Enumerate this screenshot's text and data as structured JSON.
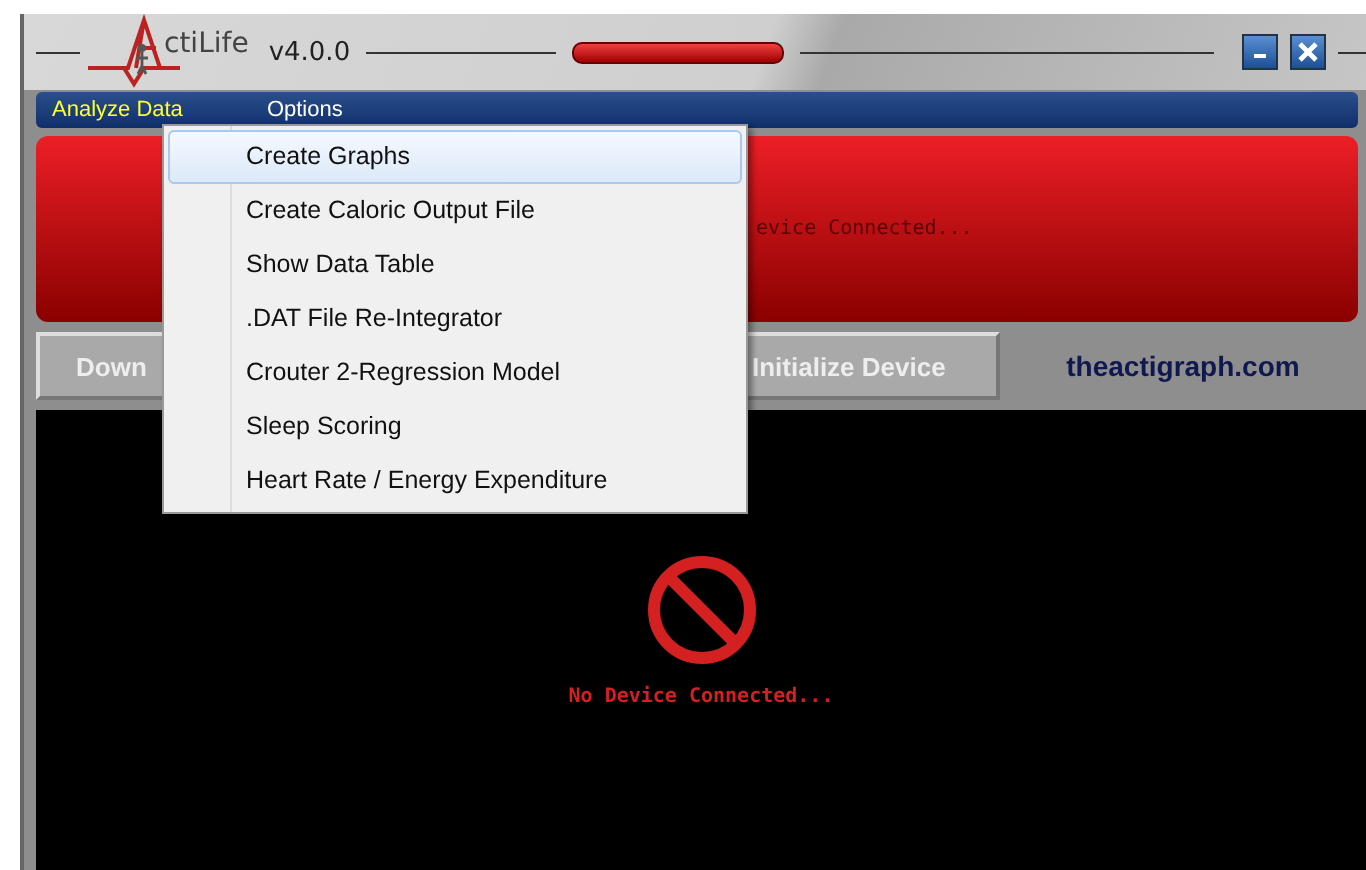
{
  "window": {
    "logo_text": "ctiLife",
    "version": "v4.0.0"
  },
  "menu_bar": [
    {
      "label": "Analyze Data",
      "selected": true
    },
    {
      "label": "Options",
      "selected": false
    }
  ],
  "dropdown": [
    {
      "label": "Create Graphs",
      "selected": true
    },
    {
      "label": "Create Caloric Output File",
      "selected": false
    },
    {
      "label": "Show Data Table",
      "selected": false
    },
    {
      "label": ".DAT File Re-Integrator",
      "selected": false
    },
    {
      "label": "Crouter 2-Regression Model",
      "selected": false
    },
    {
      "label": "Sleep Scoring",
      "selected": false
    },
    {
      "label": "Heart Rate / Energy Expenditure",
      "selected": false
    }
  ],
  "status_banner": {
    "text": "evice Connected..."
  },
  "buttons": [
    "Down",
    "Initialize Device"
  ],
  "website": "theactigraph.com",
  "device_panel": {
    "message": "No Device Connected..."
  }
}
